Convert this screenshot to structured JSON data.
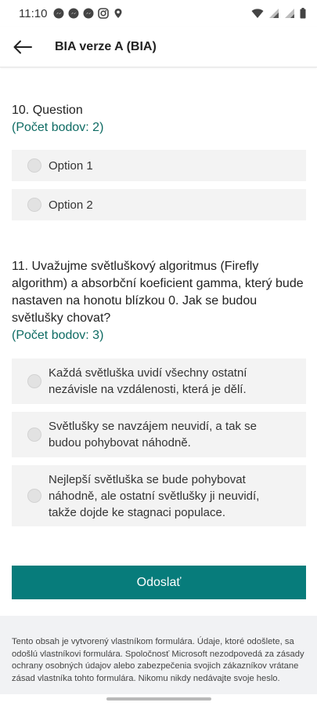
{
  "status_bar": {
    "time": "11:10",
    "left_icons": [
      "messenger-icon",
      "messenger-icon",
      "messenger-icon",
      "instagram-icon",
      "location-icon"
    ],
    "right_icons": [
      "wifi-icon",
      "signal-icon",
      "signal-icon",
      "battery-icon"
    ]
  },
  "header": {
    "title": "BIA verze A (BIA)",
    "back_icon": "arrow-left-icon"
  },
  "questions": [
    {
      "title": "10. Question",
      "points": "(Počet bodov: 2)",
      "options": [
        "Option 1",
        "Option 2"
      ]
    },
    {
      "title": "11. Uvažujme světluškový algoritmus (Firefly algorithm) a absorbční koeficient gamma, který bude nastaven na honotu blízkou 0. Jak se budou světlušky chovat?",
      "points": "(Počet bodov: 3)",
      "options": [
        "Každá světluška uvidí všechny ostatní nezávisle na vzdálenosti, která je dělí.",
        "Světlušky se navzájem neuvidí, a tak se budou pohybovat náhodně.",
        "Nejlepší světluška se bude pohybovat náhodně, ale ostatní světlušky ji neuvidí, takže dojde ke stagnaci populace."
      ]
    }
  ],
  "submit": {
    "label": "Odoslať"
  },
  "footer": {
    "text": "Tento obsah je vytvorený vlastníkom formulára. Údaje, ktoré odošlete, sa odošlú vlastníkovi formulára. Spoločnosť Microsoft nezodpovedá za zásady ochrany osobných údajov alebo zabezpečenia svojich zákazníkov vrátane zásad vlastníka tohto formulára. Nikomu nikdy nedávajte svoje heslo."
  },
  "colors": {
    "accent": "#077c7b",
    "points_text": "#0e6b63",
    "option_bg": "#f3f3f3",
    "footer_bg": "#f1f2f4"
  }
}
